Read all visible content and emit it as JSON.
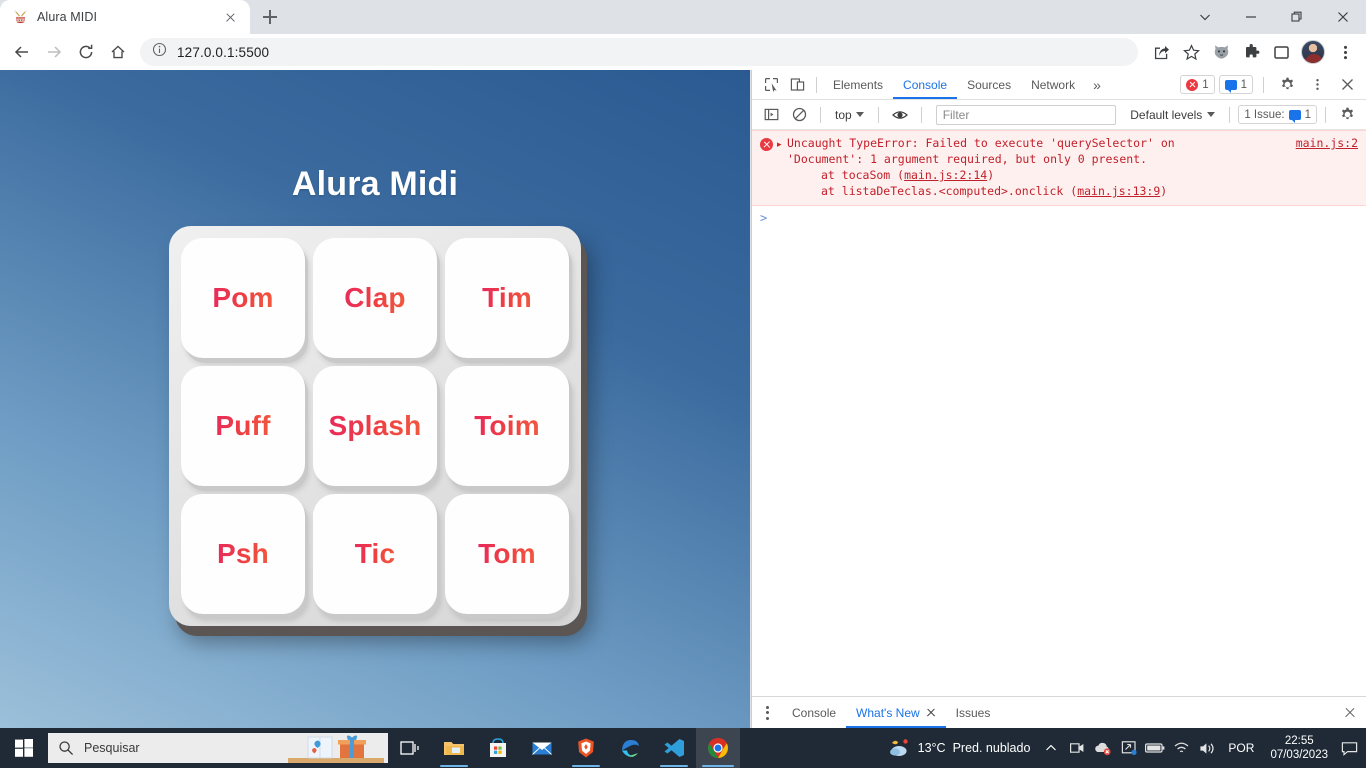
{
  "browser": {
    "tab": {
      "title": "Alura MIDI",
      "favicon": "drum-favicon",
      "close": "×"
    },
    "new_tab_tooltip": "New Tab",
    "window_controls": {
      "tab_search": "chevron-down",
      "minimize": "minimize",
      "maximize": "maximize",
      "close": "close"
    },
    "toolbar": {
      "back": "back-arrow",
      "forward": "forward-arrow",
      "reload": "reload",
      "home": "home",
      "url": "127.0.0.1:5500",
      "site_info": "info-icon",
      "share": "share-icon",
      "bookmark": "star-icon",
      "ext_cat": "cat-extension-icon",
      "ext_puzzle": "extensions-icon",
      "side_panel": "side-panel-icon",
      "profile": "profile-avatar",
      "menu": "three-dot-menu"
    }
  },
  "page": {
    "title": "Alura Midi",
    "keys": [
      {
        "label": "Pom"
      },
      {
        "label": "Clap"
      },
      {
        "label": "Tim"
      },
      {
        "label": "Puff"
      },
      {
        "label": "Splash"
      },
      {
        "label": "Toim"
      },
      {
        "label": "Psh"
      },
      {
        "label": "Tic"
      },
      {
        "label": "Tom"
      }
    ],
    "colors": {
      "key_text_start": "#e8295c",
      "key_text_end": "#f15a3e",
      "bg_top": "#2b5a92",
      "bg_bottom": "#9cc0da"
    }
  },
  "devtools": {
    "tools": {
      "inspect": "inspect-icon",
      "device": "device-toolbar-icon"
    },
    "tabs": [
      {
        "label": "Elements",
        "active": false
      },
      {
        "label": "Console",
        "active": true
      },
      {
        "label": "Sources",
        "active": false
      },
      {
        "label": "Network",
        "active": false
      }
    ],
    "more_tabs": "»",
    "error_count": "1",
    "message_count": "1",
    "settings": "gear-icon",
    "kebab": "three-dot-menu",
    "close": "close-icon",
    "console_toolbar": {
      "sidebar_toggle": "console-sidebar-icon",
      "clear": "clear-console-icon",
      "context": "top",
      "live_expression": "eye-icon",
      "filter_placeholder": "Filter",
      "filter_value": "",
      "levels": "Default levels",
      "issues_label": "1 Issue:",
      "issues_count": "1",
      "settings": "console-settings-icon"
    },
    "console_message": {
      "line1": "Uncaught TypeError: Failed to execute 'querySelector' on",
      "line2": "'Document': 1 argument required, but only 0 present.",
      "stack1_pre": "at tocaSom (",
      "stack1_link": "main.js:2:14",
      "stack1_post": ")",
      "stack2_pre": "at listaDeTeclas.<computed>.onclick (",
      "stack2_link": "main.js:13:9",
      "stack2_post": ")",
      "source_link": "main.js:2",
      "expand_arrow": "▸"
    },
    "prompt": ">",
    "drawer_tabs": [
      {
        "label": "Console",
        "active": false,
        "closable": false
      },
      {
        "label": "What's New",
        "active": true,
        "closable": true
      },
      {
        "label": "Issues",
        "active": false,
        "closable": false
      }
    ],
    "drawer_close": "close-icon"
  },
  "taskbar": {
    "start": "windows-start-icon",
    "search": {
      "placeholder": "Pesquisar",
      "icon": "search-icon"
    },
    "apps": [
      {
        "name": "task-view",
        "open": false,
        "active": false
      },
      {
        "name": "file-explorer",
        "open": true,
        "active": false
      },
      {
        "name": "microsoft-store",
        "open": false,
        "active": false
      },
      {
        "name": "mail",
        "open": false,
        "active": false
      },
      {
        "name": "brave-browser",
        "open": true,
        "active": false
      },
      {
        "name": "microsoft-edge",
        "open": false,
        "active": false
      },
      {
        "name": "vs-code",
        "open": true,
        "active": false
      },
      {
        "name": "google-chrome",
        "open": true,
        "active": true
      }
    ],
    "tray": {
      "weather_temp": "13°C",
      "weather_desc": "Pred. nublado",
      "overflow": "show-hidden-icons",
      "icons": [
        "camera-icon",
        "cloud-sync-icon",
        "onedrive-icon",
        "battery-icon",
        "wifi-icon",
        "volume-icon"
      ],
      "language": "POR",
      "time": "22:55",
      "date": "07/03/2023",
      "action_center": "notification-icon"
    }
  }
}
